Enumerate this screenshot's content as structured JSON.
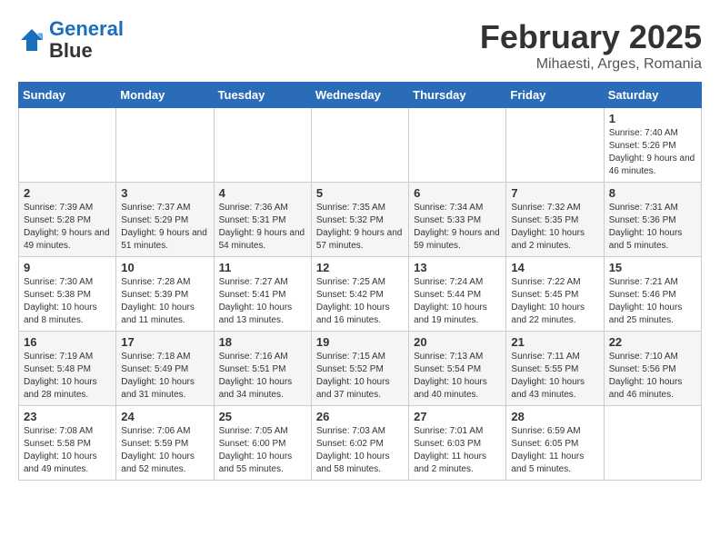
{
  "logo": {
    "line1": "General",
    "line2": "Blue"
  },
  "title": "February 2025",
  "location": "Mihaesti, Arges, Romania",
  "weekdays": [
    "Sunday",
    "Monday",
    "Tuesday",
    "Wednesday",
    "Thursday",
    "Friday",
    "Saturday"
  ],
  "weeks": [
    [
      {
        "day": "",
        "info": ""
      },
      {
        "day": "",
        "info": ""
      },
      {
        "day": "",
        "info": ""
      },
      {
        "day": "",
        "info": ""
      },
      {
        "day": "",
        "info": ""
      },
      {
        "day": "",
        "info": ""
      },
      {
        "day": "1",
        "info": "Sunrise: 7:40 AM\nSunset: 5:26 PM\nDaylight: 9 hours and 46 minutes."
      }
    ],
    [
      {
        "day": "2",
        "info": "Sunrise: 7:39 AM\nSunset: 5:28 PM\nDaylight: 9 hours and 49 minutes."
      },
      {
        "day": "3",
        "info": "Sunrise: 7:37 AM\nSunset: 5:29 PM\nDaylight: 9 hours and 51 minutes."
      },
      {
        "day": "4",
        "info": "Sunrise: 7:36 AM\nSunset: 5:31 PM\nDaylight: 9 hours and 54 minutes."
      },
      {
        "day": "5",
        "info": "Sunrise: 7:35 AM\nSunset: 5:32 PM\nDaylight: 9 hours and 57 minutes."
      },
      {
        "day": "6",
        "info": "Sunrise: 7:34 AM\nSunset: 5:33 PM\nDaylight: 9 hours and 59 minutes."
      },
      {
        "day": "7",
        "info": "Sunrise: 7:32 AM\nSunset: 5:35 PM\nDaylight: 10 hours and 2 minutes."
      },
      {
        "day": "8",
        "info": "Sunrise: 7:31 AM\nSunset: 5:36 PM\nDaylight: 10 hours and 5 minutes."
      }
    ],
    [
      {
        "day": "9",
        "info": "Sunrise: 7:30 AM\nSunset: 5:38 PM\nDaylight: 10 hours and 8 minutes."
      },
      {
        "day": "10",
        "info": "Sunrise: 7:28 AM\nSunset: 5:39 PM\nDaylight: 10 hours and 11 minutes."
      },
      {
        "day": "11",
        "info": "Sunrise: 7:27 AM\nSunset: 5:41 PM\nDaylight: 10 hours and 13 minutes."
      },
      {
        "day": "12",
        "info": "Sunrise: 7:25 AM\nSunset: 5:42 PM\nDaylight: 10 hours and 16 minutes."
      },
      {
        "day": "13",
        "info": "Sunrise: 7:24 AM\nSunset: 5:44 PM\nDaylight: 10 hours and 19 minutes."
      },
      {
        "day": "14",
        "info": "Sunrise: 7:22 AM\nSunset: 5:45 PM\nDaylight: 10 hours and 22 minutes."
      },
      {
        "day": "15",
        "info": "Sunrise: 7:21 AM\nSunset: 5:46 PM\nDaylight: 10 hours and 25 minutes."
      }
    ],
    [
      {
        "day": "16",
        "info": "Sunrise: 7:19 AM\nSunset: 5:48 PM\nDaylight: 10 hours and 28 minutes."
      },
      {
        "day": "17",
        "info": "Sunrise: 7:18 AM\nSunset: 5:49 PM\nDaylight: 10 hours and 31 minutes."
      },
      {
        "day": "18",
        "info": "Sunrise: 7:16 AM\nSunset: 5:51 PM\nDaylight: 10 hours and 34 minutes."
      },
      {
        "day": "19",
        "info": "Sunrise: 7:15 AM\nSunset: 5:52 PM\nDaylight: 10 hours and 37 minutes."
      },
      {
        "day": "20",
        "info": "Sunrise: 7:13 AM\nSunset: 5:54 PM\nDaylight: 10 hours and 40 minutes."
      },
      {
        "day": "21",
        "info": "Sunrise: 7:11 AM\nSunset: 5:55 PM\nDaylight: 10 hours and 43 minutes."
      },
      {
        "day": "22",
        "info": "Sunrise: 7:10 AM\nSunset: 5:56 PM\nDaylight: 10 hours and 46 minutes."
      }
    ],
    [
      {
        "day": "23",
        "info": "Sunrise: 7:08 AM\nSunset: 5:58 PM\nDaylight: 10 hours and 49 minutes."
      },
      {
        "day": "24",
        "info": "Sunrise: 7:06 AM\nSunset: 5:59 PM\nDaylight: 10 hours and 52 minutes."
      },
      {
        "day": "25",
        "info": "Sunrise: 7:05 AM\nSunset: 6:00 PM\nDaylight: 10 hours and 55 minutes."
      },
      {
        "day": "26",
        "info": "Sunrise: 7:03 AM\nSunset: 6:02 PM\nDaylight: 10 hours and 58 minutes."
      },
      {
        "day": "27",
        "info": "Sunrise: 7:01 AM\nSunset: 6:03 PM\nDaylight: 11 hours and 2 minutes."
      },
      {
        "day": "28",
        "info": "Sunrise: 6:59 AM\nSunset: 6:05 PM\nDaylight: 11 hours and 5 minutes."
      },
      {
        "day": "",
        "info": ""
      }
    ]
  ]
}
